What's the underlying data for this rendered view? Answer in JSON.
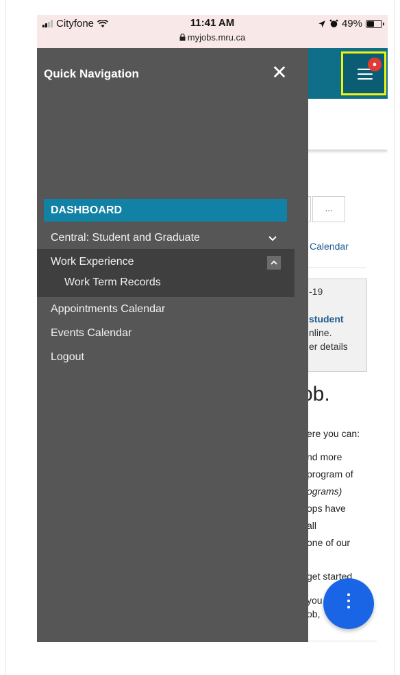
{
  "status_bar": {
    "carrier": "Cityfone",
    "time": "11:41 AM",
    "url": "myjobs.mru.ca",
    "battery": "49%",
    "battery_level": 0.49
  },
  "drawer": {
    "title": "Quick Navigation",
    "close_label": "✕",
    "dashboard_label": "DASHBOARD",
    "items": [
      {
        "label": "Central: Student and Graduate",
        "expanded": false
      },
      {
        "label": "Work Experience",
        "expanded": true,
        "children": [
          {
            "label": "Work Term Records"
          }
        ]
      },
      {
        "label": "Appointments Calendar"
      },
      {
        "label": "Events Calendar"
      },
      {
        "label": "Logout"
      }
    ]
  },
  "background_page": {
    "more_button": "...",
    "calendar_link": "Calendar",
    "info_box": {
      "date_fragment": "-19",
      "student": "student",
      "online": "nline.",
      "details": "er details"
    },
    "headline_fragment": "ob.",
    "body_lines": [
      "ere you can:",
      "nd more",
      "program of",
      "ograms)",
      "ops have",
      "all",
      "one of our",
      "get started",
      "you",
      "ob,"
    ],
    "notification_badge": "●"
  },
  "colors": {
    "drawer_bg": "#565656",
    "dashboard_accent": "#1181a6",
    "header_teal": "#0f6f89",
    "highlight_yellow": "#f3f20d",
    "fab_blue": "#1a64e6",
    "badge_red": "#e53935"
  },
  "icons": {
    "signal": "cellular-signal-icon",
    "wifi": "wifi-icon",
    "lock": "lock-icon",
    "location": "location-arrow-icon",
    "alarm": "alarm-icon",
    "battery": "battery-icon",
    "close": "close-icon",
    "chevron_down": "chevron-down-icon",
    "chevron_up": "chevron-up-icon",
    "hamburger": "hamburger-menu-icon",
    "more": "vertical-dots-icon"
  }
}
